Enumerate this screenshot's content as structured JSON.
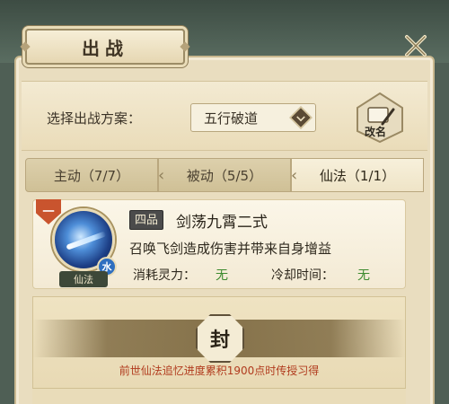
{
  "header": {
    "title": "出战",
    "close_icon": "close-icon"
  },
  "plan": {
    "label": "选择出战方案：",
    "selected": "五行破道",
    "rename_label": "改名"
  },
  "tabs": [
    {
      "label": "主动（7/7）",
      "active": false
    },
    {
      "label": "被动（5/5）",
      "active": false
    },
    {
      "label": "仙法（1/1）",
      "active": true
    }
  ],
  "skill": {
    "slot": "一",
    "grade": "四品",
    "name": "剑荡九霄二式",
    "type": "仙法",
    "element": "水",
    "description": "召唤飞剑造成伤害并带来自身增益",
    "cost_label": "消耗灵力：",
    "cost_value": "无",
    "cooldown_label": "冷却时间：",
    "cooldown_value": "无"
  },
  "locked_slot": {
    "seal": "封",
    "hint": "前世仙法追忆进度累积1900点时传授习得"
  },
  "colors": {
    "accent_green": "#3c8a2e",
    "hint_red": "#b13b1e",
    "panel": "#e9ddbf"
  }
}
